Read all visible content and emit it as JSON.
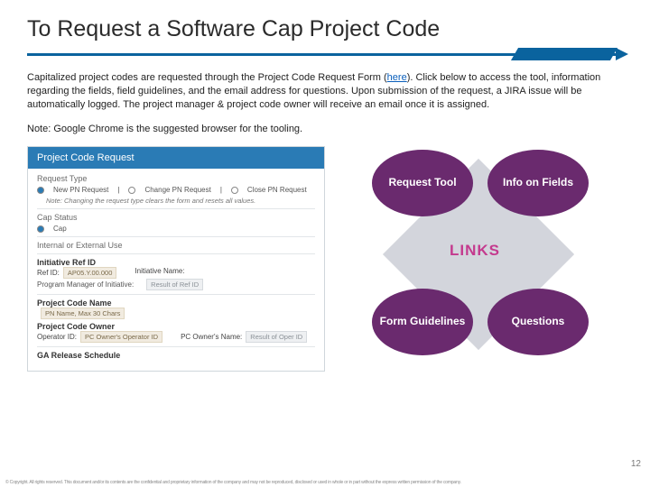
{
  "title": "To Request a Software Cap Project Code",
  "paragraph1_prefix": "Capitalized project codes are requested through the Project Code Request Form (",
  "paragraph1_link": "here",
  "paragraph1_suffix": ").   Click below to access the tool, information regarding the fields, field guidelines, and the email address for questions. Upon submission of the request, a JIRA issue will be automatically logged.  The project manager & project code owner will receive an email once it is assigned.",
  "paragraph2": "Note: Google Chrome is the suggested browser for the tooling.",
  "screenshot": {
    "header": "Project Code Request",
    "request_type_label": "Request Type",
    "rt_new": "New PN Request",
    "rt_change": "Change PN Request",
    "rt_close": "Close PN Request",
    "rt_note": "Note: Changing the request type clears the form and resets all values.",
    "cap_status_label": "Cap Status",
    "cap_status_opt": "Cap",
    "internal_label": "Internal or External Use",
    "initiative_label": "Initiative Ref ID",
    "ref_id_label": "Ref ID:",
    "ref_id_placeholder": "AP05.Y.00.000",
    "initiative_name_label": "Initiative Name:",
    "pm_label": "Program Manager of Initiative:",
    "pm_placeholder": "Result of Ref ID",
    "pc_name_label": "Project Code Name",
    "pc_name_placeholder": "PN Name, Max 30 Chars",
    "pc_owner_label": "Project Code Owner",
    "operator_id_label": "Operator ID:",
    "operator_id_placeholder": "PC Owner's Operator ID",
    "pc_owner_name_label": "PC Owner's Name:",
    "pc_owner_name_placeholder": "Result of Oper ID",
    "ga_label": "GA Release Schedule"
  },
  "links": {
    "center": "LINKS",
    "tl": "Request Tool",
    "tr": "Info on Fields",
    "bl": "Form Guidelines",
    "br": "Questions"
  },
  "page_number": "12",
  "fineprint": "© Copyright. All rights reserved. This document and/or its contents are the confidential and proprietary information of the company and may not be reproduced, disclosed or used in whole or in part without the express written permission of the company."
}
